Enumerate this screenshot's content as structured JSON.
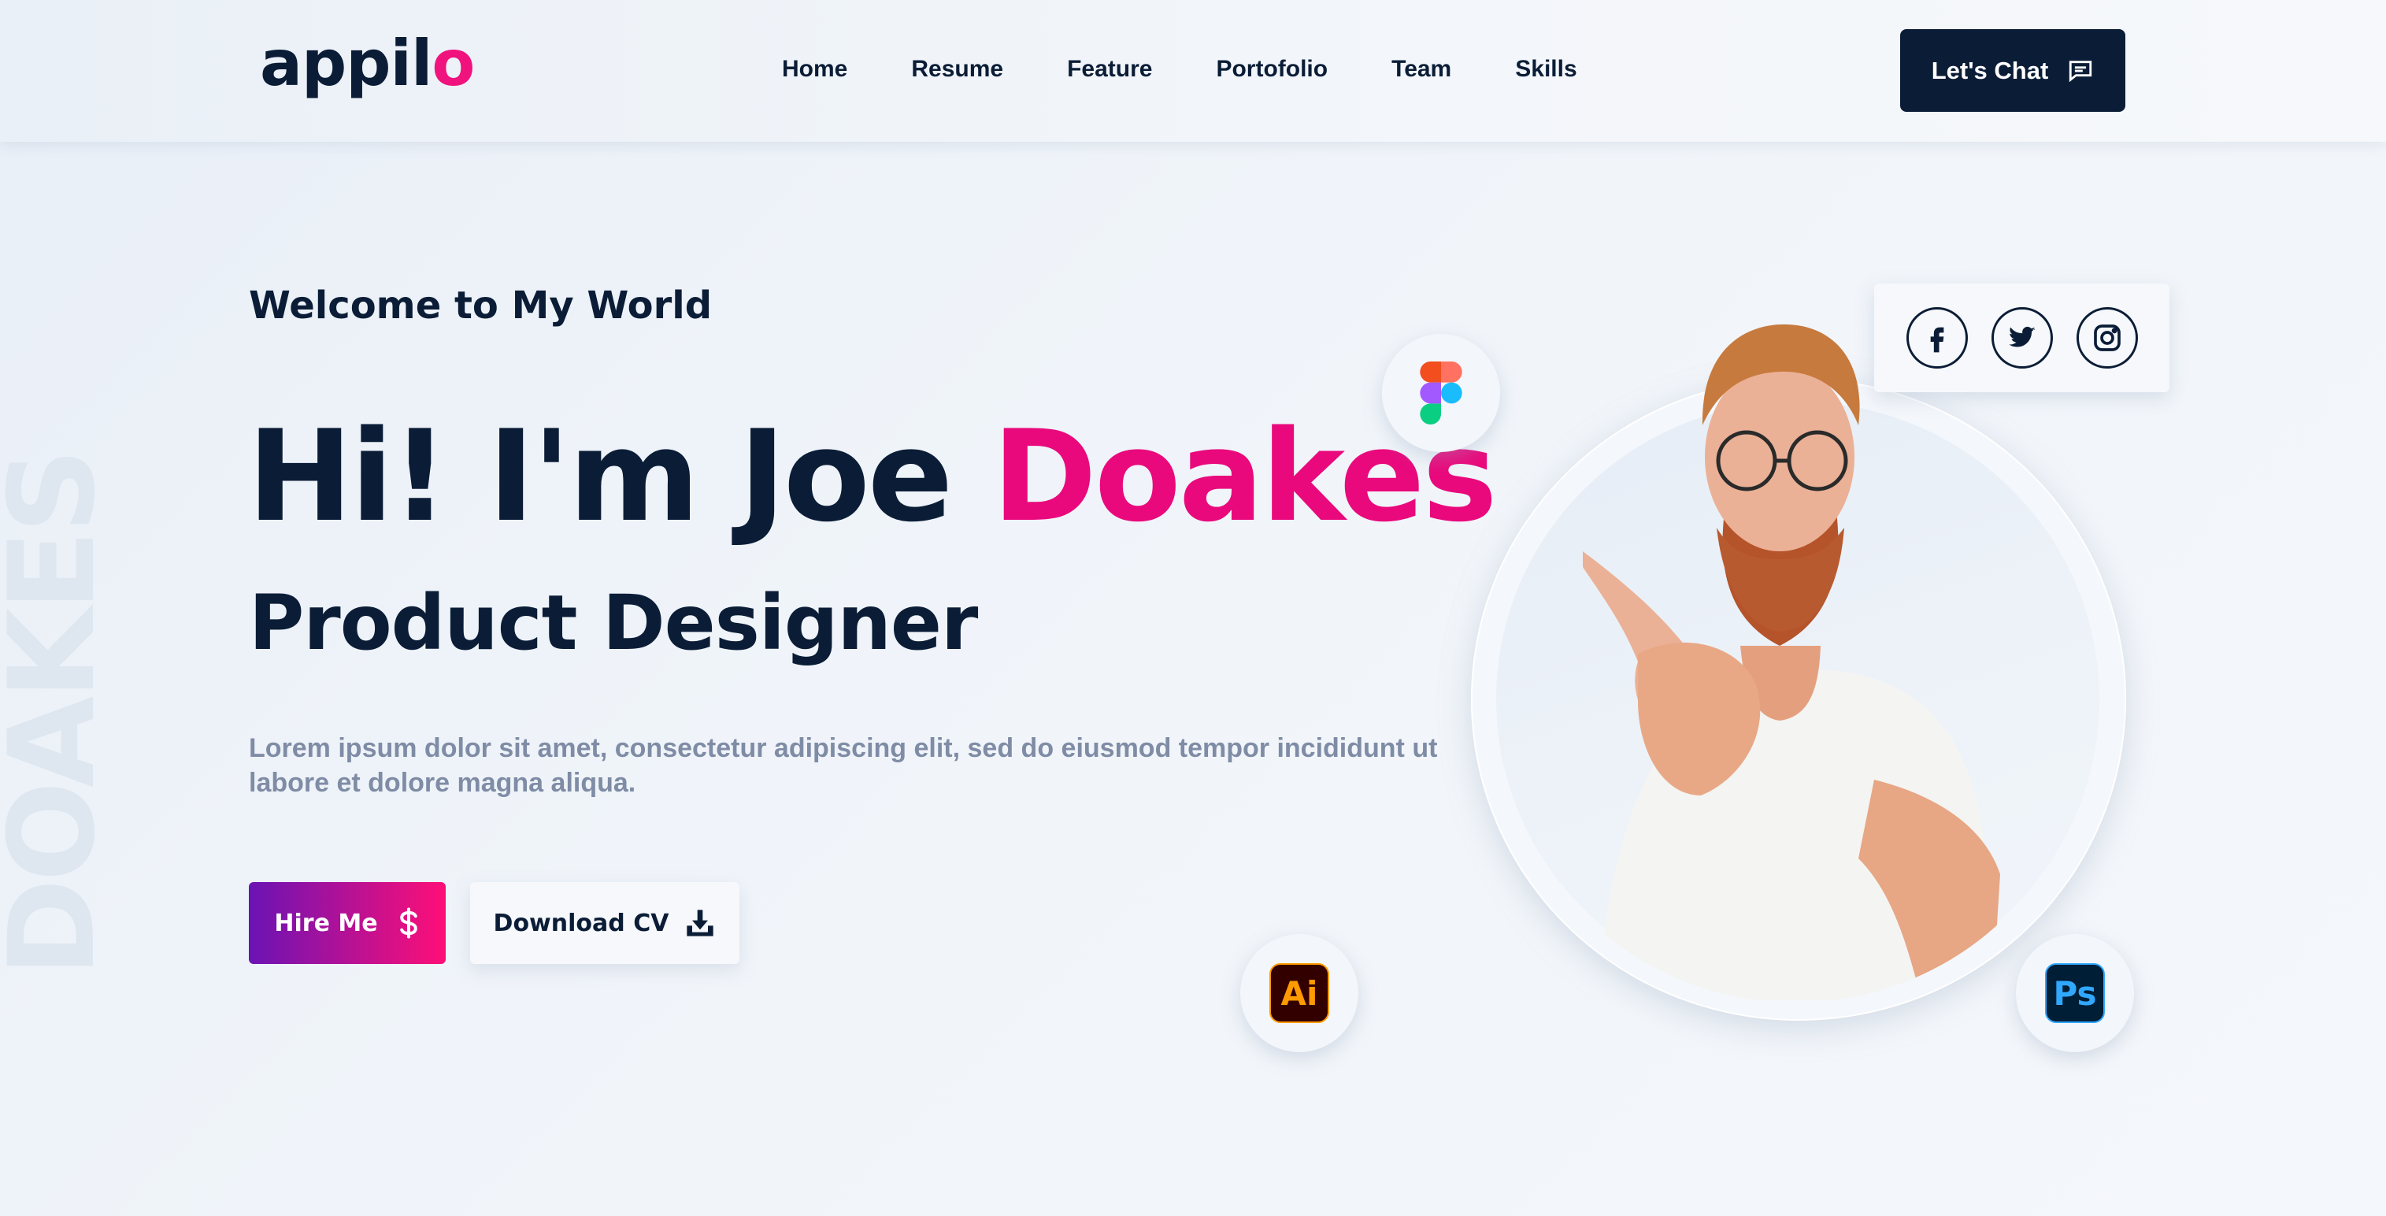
{
  "brand": {
    "logo_main": "appil",
    "logo_accent": "o"
  },
  "nav": {
    "items": [
      {
        "label": "Home"
      },
      {
        "label": "Resume"
      },
      {
        "label": "Feature"
      },
      {
        "label": "Portofolio"
      },
      {
        "label": "Team"
      },
      {
        "label": "Skills"
      }
    ],
    "cta_label": "Let's Chat"
  },
  "hero": {
    "background_word": "DOAKES",
    "welcome": "Welcome to My World",
    "greeting": "Hi! I'm Joe ",
    "name_highlight": "Doakes",
    "role": "Product Designer",
    "description": "Lorem ipsum dolor sit amet, consectetur adipiscing elit, sed do eiusmod tempor incididunt ut labore et dolore magna aliqua.",
    "hire_label": "Hire Me",
    "cv_label": "Download CV"
  },
  "badges": {
    "ai_label": "Ai",
    "ps_label": "Ps"
  },
  "icons": {
    "chat": "chat-bubble-icon",
    "dollar": "dollar-icon",
    "download": "download-icon",
    "facebook": "facebook-icon",
    "twitter": "twitter-icon",
    "instagram": "instagram-icon",
    "figma": "figma-icon"
  },
  "colors": {
    "primary_dark": "#0b1d36",
    "accent_pink": "#e9097c",
    "gradient_start": "#6a13b4",
    "gradient_end": "#ff0f77"
  }
}
